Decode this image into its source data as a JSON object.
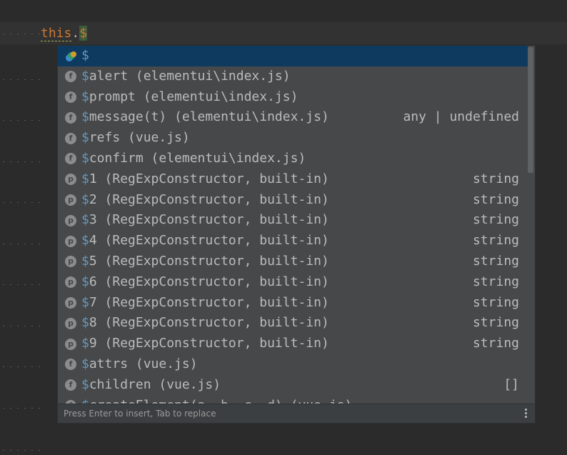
{
  "editor": {
    "code_keyword": "this",
    "code_dot": ".",
    "code_typed": "$"
  },
  "completion": {
    "items": [
      {
        "icon": "vue-icon",
        "icon_letter": "",
        "prefix": "$",
        "rest": "",
        "type": "",
        "selected": true
      },
      {
        "icon": "function-icon",
        "icon_letter": "f",
        "prefix": "$",
        "rest": "alert (elementui\\index.js)",
        "type": ""
      },
      {
        "icon": "function-icon",
        "icon_letter": "f",
        "prefix": "$",
        "rest": "prompt (elementui\\index.js)",
        "type": ""
      },
      {
        "icon": "function-icon",
        "icon_letter": "f",
        "prefix": "$",
        "rest": "message(t) (elementui\\index.js)",
        "type": "any | undefined"
      },
      {
        "icon": "function-icon",
        "icon_letter": "f",
        "prefix": "$",
        "rest": "refs (vue.js)",
        "type": ""
      },
      {
        "icon": "function-icon",
        "icon_letter": "f",
        "prefix": "$",
        "rest": "confirm (elementui\\index.js)",
        "type": ""
      },
      {
        "icon": "property-icon",
        "icon_letter": "p",
        "prefix": "$",
        "rest": "1 (RegExpConstructor, built-in)",
        "type": "string"
      },
      {
        "icon": "property-icon",
        "icon_letter": "p",
        "prefix": "$",
        "rest": "2 (RegExpConstructor, built-in)",
        "type": "string"
      },
      {
        "icon": "property-icon",
        "icon_letter": "p",
        "prefix": "$",
        "rest": "3 (RegExpConstructor, built-in)",
        "type": "string"
      },
      {
        "icon": "property-icon",
        "icon_letter": "p",
        "prefix": "$",
        "rest": "4 (RegExpConstructor, built-in)",
        "type": "string"
      },
      {
        "icon": "property-icon",
        "icon_letter": "p",
        "prefix": "$",
        "rest": "5 (RegExpConstructor, built-in)",
        "type": "string"
      },
      {
        "icon": "property-icon",
        "icon_letter": "p",
        "prefix": "$",
        "rest": "6 (RegExpConstructor, built-in)",
        "type": "string"
      },
      {
        "icon": "property-icon",
        "icon_letter": "p",
        "prefix": "$",
        "rest": "7 (RegExpConstructor, built-in)",
        "type": "string"
      },
      {
        "icon": "property-icon",
        "icon_letter": "p",
        "prefix": "$",
        "rest": "8 (RegExpConstructor, built-in)",
        "type": "string"
      },
      {
        "icon": "property-icon",
        "icon_letter": "p",
        "prefix": "$",
        "rest": "9 (RegExpConstructor, built-in)",
        "type": "string"
      },
      {
        "icon": "function-icon",
        "icon_letter": "f",
        "prefix": "$",
        "rest": "attrs (vue.js)",
        "type": ""
      },
      {
        "icon": "function-icon",
        "icon_letter": "f",
        "prefix": "$",
        "rest": "children (vue.js)",
        "type": "[]"
      },
      {
        "icon": "function-icon",
        "icon_letter": "f",
        "prefix": "$",
        "rest": "createElement(a, b, c, d) (vue.js)",
        "type": ""
      }
    ],
    "footer_hint": "Press Enter to insert, Tab to replace"
  },
  "colors": {
    "selection": "#0d3a5e",
    "popup_bg": "#46484a",
    "keyword": "#cc7832"
  }
}
